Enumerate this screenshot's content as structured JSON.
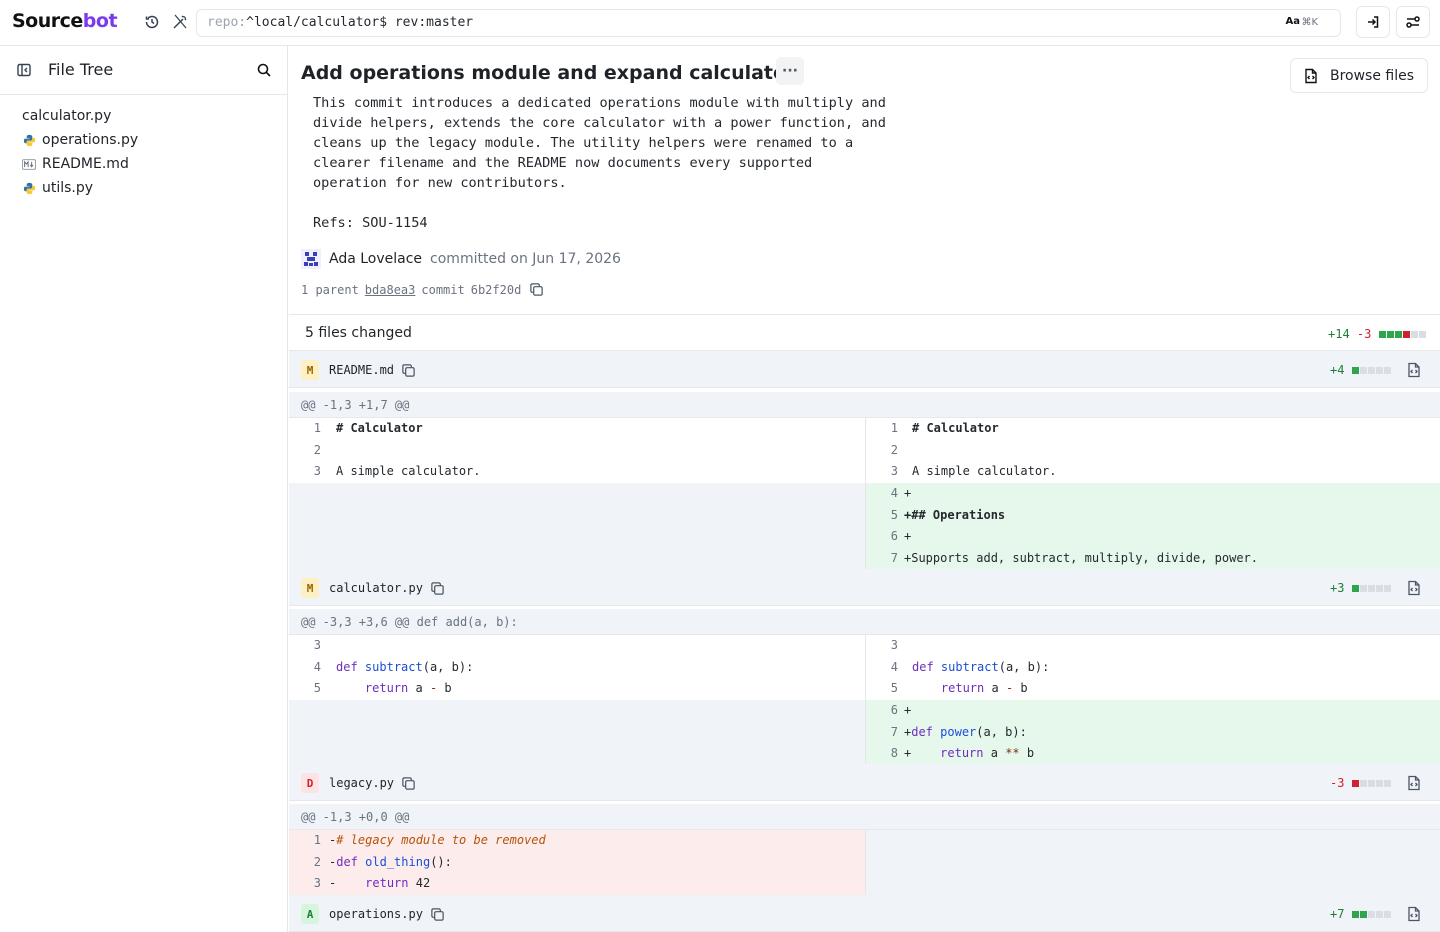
{
  "app": {
    "logo_text_1": "Source",
    "logo_text_2": "bot",
    "repo_prefix": "repo:",
    "repo_path": "^local/calculator$ ",
    "repo_rev": "rev:master",
    "aa_label": "Aa",
    "kbd": "⌘K"
  },
  "sidebar": {
    "title": "File Tree",
    "files": [
      {
        "name": "calculator.py",
        "icon": "none"
      },
      {
        "name": "operations.py",
        "icon": "python-icon"
      },
      {
        "name": "README.md",
        "icon": "markdown-icon"
      },
      {
        "name": "utils.py",
        "icon": "python-icon"
      }
    ]
  },
  "commit": {
    "title": "Add operations module and expand calculator",
    "more_label": "···",
    "browse_label": "Browse files",
    "message_lines": [
      "This commit introduces a dedicated operations module with multiply and",
      "divide helpers, extends the core calculator with a power function, and",
      "cleans up the legacy module. The utility helpers were renamed to a",
      "clearer filename and the README now documents every supported",
      "operation for new contributors."
    ],
    "refs": "Refs: SOU-1154",
    "author": "Ada Lovelace",
    "committed": "committed on Jun 17, 2026",
    "parent_label": "1 parent",
    "parent_hash": "bda8ea3",
    "commit_label": "commit",
    "commit_hash": "6b2f20d"
  },
  "summary": {
    "label": "5 files changed",
    "additions": "+14",
    "deletions": "-3"
  },
  "files": {
    "readme": {
      "status": "M",
      "name": "README.md",
      "stat": "+4",
      "hunk": "@@ -1,3 +1,7 @@",
      "left": [
        {
          "n": "1",
          "t": "# Calculator"
        },
        {
          "n": "2",
          "t": ""
        },
        {
          "n": "3",
          "t": "A simple calculator."
        }
      ],
      "right": [
        {
          "n": "1",
          "t": "# Calculator"
        },
        {
          "n": "2",
          "t": ""
        },
        {
          "n": "3",
          "t": "A simple calculator."
        },
        {
          "n": "4",
          "t": "+"
        },
        {
          "n": "5",
          "t": "+## Operations"
        },
        {
          "n": "6",
          "t": "+"
        },
        {
          "n": "7",
          "t": "+Supports add, subtract, multiply, divide, power."
        }
      ]
    },
    "calculator": {
      "status": "M",
      "name": "calculator.py",
      "stat": "+3",
      "hunk": "@@ -3,3 +3,6 @@ def add(a, b):",
      "left_nums": [
        "3",
        "4",
        "5"
      ],
      "right_nums": [
        "3",
        "4",
        "5",
        "6",
        "7",
        "8"
      ],
      "def_kw": "def",
      "subtract_fn": "subtract",
      "subtract_args": "(a, b):",
      "return_kw": "return",
      "sub_expr_a": " a ",
      "sub_op": "-",
      "sub_expr_b": " b",
      "plus": "+",
      "power_fn": "power",
      "power_args": "(a, b):",
      "pow_op": "**",
      "pow_expr_a": " a ",
      "pow_expr_b": " b",
      "indent": "    "
    },
    "legacy": {
      "status": "D",
      "name": "legacy.py",
      "stat": "-3",
      "hunk": "@@ -1,3 +0,0 @@",
      "nums": [
        "1",
        "2",
        "3"
      ],
      "minus": "-",
      "comment": "# legacy module to be removed",
      "def_kw": "def",
      "fn": "old_thing",
      "args": "():",
      "return_kw": "return",
      "ret_val": " 42",
      "indent": "    "
    },
    "operations": {
      "status": "A",
      "name": "operations.py",
      "stat": "+7"
    }
  }
}
